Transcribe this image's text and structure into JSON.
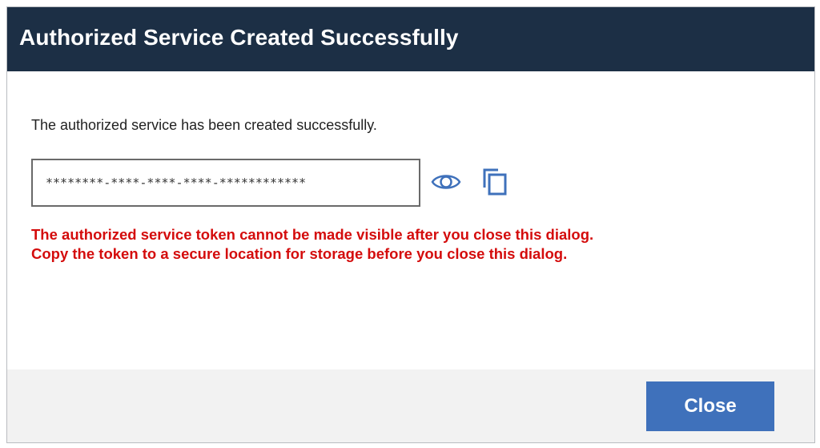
{
  "dialog": {
    "title": "Authorized Service Created Successfully",
    "message": "The authorized service has been created successfully.",
    "token_field": {
      "value": "********-****-****-****-************"
    },
    "icons": {
      "show_token": "eye-icon",
      "copy_token": "copy-icon"
    },
    "warning": {
      "line1": "The authorized service token cannot be made visible after you close this dialog.",
      "line2": "Copy the token to a secure location for storage before you close this dialog."
    },
    "close_label": "Close"
  },
  "colors": {
    "header_background": "#1c2f45",
    "header_text": "#ffffff",
    "warning_text": "#d40c0c",
    "primary_button": "#3f71bb",
    "icon_blue": "#3f71bb",
    "footer_background": "#f2f2f2"
  }
}
